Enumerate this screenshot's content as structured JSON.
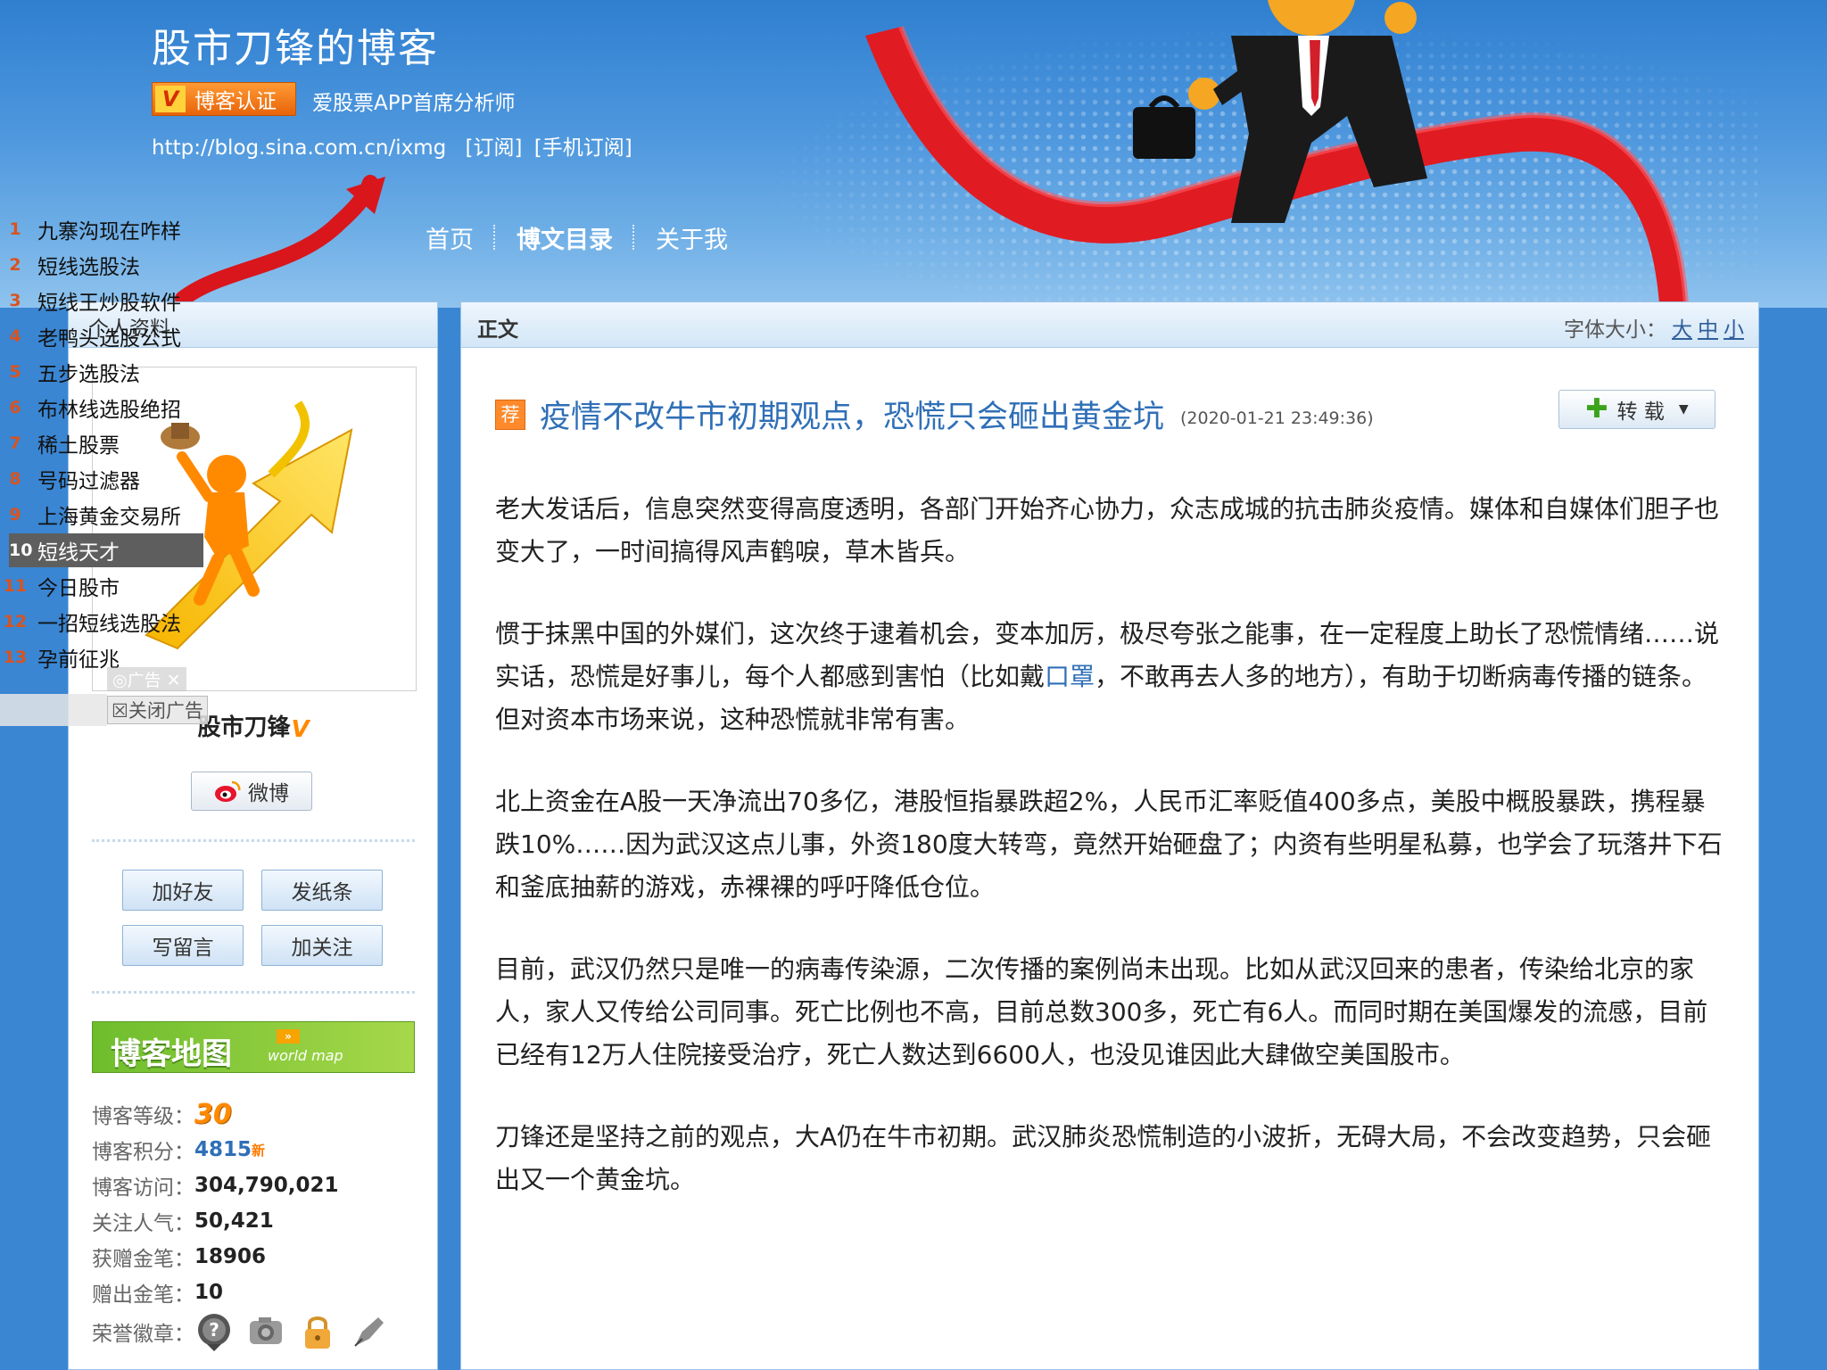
{
  "header": {
    "blog_title": "股市刀锋的博客",
    "verify_badge": "博客认证",
    "verify_desc": "爱股票APP首席分析师",
    "url": "http://blog.sina.com.cn/ixmg",
    "subscribe": "[订阅]",
    "mobile_subscribe": "[手机订阅]"
  },
  "nav": {
    "items": [
      {
        "label": "首页"
      },
      {
        "label": "博文目录"
      },
      {
        "label": "关于我"
      }
    ]
  },
  "ad_list": {
    "items": [
      {
        "num": "1",
        "text": "九寨沟现在咋样"
      },
      {
        "num": "2",
        "text": "短线选股法"
      },
      {
        "num": "3",
        "text": "短线王炒股软件"
      },
      {
        "num": "4",
        "text": "老鸭头选股公式"
      },
      {
        "num": "5",
        "text": "五步选股法"
      },
      {
        "num": "6",
        "text": "布林线选股绝招"
      },
      {
        "num": "7",
        "text": "稀土股票"
      },
      {
        "num": "8",
        "text": "号码过滤器"
      },
      {
        "num": "9",
        "text": "上海黄金交易所"
      },
      {
        "num": "10",
        "text": "短线天才"
      },
      {
        "num": "11",
        "text": "今日股市"
      },
      {
        "num": "12",
        "text": "一招短线选股法"
      },
      {
        "num": "13",
        "text": "孕前征兆"
      }
    ],
    "selected_index": 9,
    "ad_mark": "广告",
    "close_ad": "关闭广告"
  },
  "left_panel": {
    "title": "个人资料",
    "blog_name": "股市刀锋",
    "weibo_label": "微博",
    "buttons": {
      "add_friend": "加好友",
      "send_note": "发纸条",
      "write_message": "写留言",
      "follow": "加关注"
    },
    "blog_map": {
      "title": "博客地图",
      "subtitle": "world map"
    },
    "stats": {
      "level_label": "博客等级：",
      "level_value": "30",
      "points_label": "博客积分：",
      "points_value": "4815",
      "points_new": "新",
      "visits_label": "博客访问：",
      "visits_value": "304,790,021",
      "popularity_label": "关注人气：",
      "popularity_value": "50,421",
      "received_label": "获赠金笔：",
      "received_value": "18906",
      "given_label": "赠出金笔：",
      "given_value": "10",
      "badges_label": "荣誉徽章："
    }
  },
  "main": {
    "head_title": "正文",
    "font_size_label": "字体大小：",
    "font_sizes": [
      "大",
      "中",
      "小"
    ],
    "rec_badge": "荐",
    "article_title": "疫情不改牛市初期观点，恐慌只会砸出黄金坑",
    "article_date": "(2020-01-21 23:49:36)",
    "repost_label": "转 载",
    "paragraphs": {
      "p1": "老大发话后，信息突然变得高度透明，各部门开始齐心协力，众志成城的抗击肺炎疫情。媒体和自媒体们胆子也变大了，一时间搞得风声鹤唳，草木皆兵。",
      "p2_a": "惯于抹黑中国的外媒们，这次终于逮着机会，变本加厉，极尽夸张之能事，在一定程度上助长了恐慌情绪……说实话，恐慌是好事儿，每个人都感到害怕（比如戴",
      "p2_kw": "口罩",
      "p2_b": "，不敢再去人多的地方），有助于切断病毒传播的链条。但对资本市场来说，这种恐慌就非常有害。",
      "p3": "北上资金在A股一天净流出70多亿，港股恒指暴跌超2%，人民币汇率贬值400多点，美股中概股暴跌，携程暴跌10%……因为武汉这点儿事，外资180度大转弯，竟然开始砸盘了；内资有些明星私募，也学会了玩落井下石和釜底抽薪的游戏，赤裸裸的呼吁降低仓位。",
      "p4": "目前，武汉仍然只是唯一的病毒传染源，二次传播的案例尚未出现。比如从武汉回来的患者，传染给北京的家人，家人又传给公司同事。死亡比例也不高，目前总数300多，死亡有6人。而同时期在美国爆发的流感，目前已经有12万人住院接受治疗，死亡人数达到6600人，也没见谁因此大肆做空美国股市。",
      "p5": "刀锋还是坚持之前的观点，大A仍在牛市初期。武汉肺炎恐慌制造的小波折，无碍大局，不会改变趋势，只会砸出又一个黄金坑。"
    }
  },
  "colors": {
    "page_bg": "#3a86d3",
    "title_blue": "#2f6fb7",
    "accent_orange": "#ff8a2b",
    "arrow_red": "#e01b22"
  }
}
